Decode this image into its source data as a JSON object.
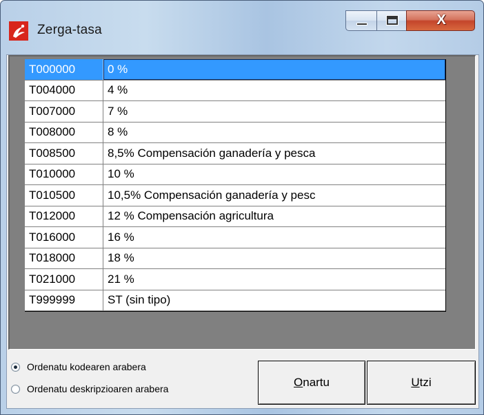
{
  "window": {
    "title": "Zerga-tasa",
    "close_glyph": "X"
  },
  "icons": {
    "app": "app-logo-icon",
    "minimize": "minimize-icon",
    "maximize": "maximize-icon",
    "close": "close-icon"
  },
  "colors": {
    "selection": "#3399ff",
    "list_background": "#808080",
    "close_button": "#c4452b"
  },
  "list": {
    "rows": [
      {
        "code": "T000000",
        "desc": "0 %",
        "selected": true
      },
      {
        "code": "T004000",
        "desc": "4 %"
      },
      {
        "code": "T007000",
        "desc": "7 %"
      },
      {
        "code": "T008000",
        "desc": "8 %"
      },
      {
        "code": "T008500",
        "desc": "8,5% Compensación ganadería y pesca"
      },
      {
        "code": "T010000",
        "desc": "10 %"
      },
      {
        "code": "T010500",
        "desc": "10,5% Compensación ganadería y pesc"
      },
      {
        "code": "T012000",
        "desc": "12 % Compensación agricultura"
      },
      {
        "code": "T016000",
        "desc": "16 %"
      },
      {
        "code": "T018000",
        "desc": "18 %"
      },
      {
        "code": "T021000",
        "desc": "21 %"
      },
      {
        "code": "T999999",
        "desc": "ST (sin tipo)"
      }
    ]
  },
  "sort": {
    "by_code": {
      "label": "Ordenatu kodearen arabera",
      "checked": true
    },
    "by_description": {
      "label": "Ordenatu deskripzioaren arabera",
      "checked": false
    }
  },
  "buttons": {
    "ok": {
      "mnemonic": "O",
      "rest": "nartu"
    },
    "cancel": {
      "mnemonic": "U",
      "rest": "tzi"
    }
  }
}
